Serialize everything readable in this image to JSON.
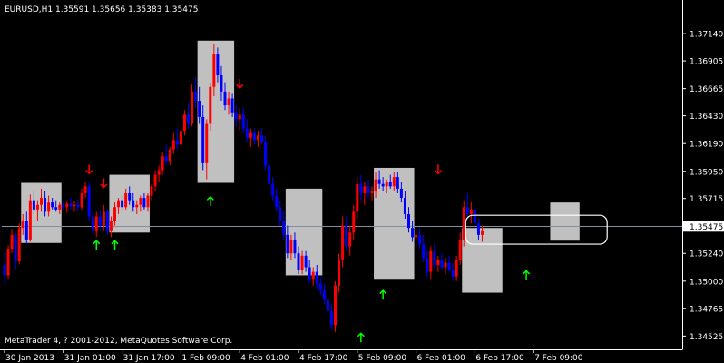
{
  "chart_data": {
    "type": "candlestick",
    "title": "EURUSD,H1  1.35591 1.35656 1.35383 1.35475",
    "footer": "MetaTrader 4, ? 2001-2012, MetaQuotes Software Corp.",
    "price_axis": {
      "ylim": [
        1.3441,
        1.374
      ],
      "ticks": [
        "1.37140",
        "1.36905",
        "1.36665",
        "1.36430",
        "1.36190",
        "1.35950",
        "1.35715",
        "1.35475",
        "1.35240",
        "1.35000",
        "1.34765",
        "1.34525"
      ],
      "current_price_label": "1.35475",
      "current_price": 1.35475
    },
    "time_axis": {
      "labels": [
        "30 Jan 2013",
        "31 Jan 01:00",
        "31 Jan 17:00",
        "1 Feb 09:00",
        "4 Feb 01:00",
        "4 Feb 17:00",
        "5 Feb 09:00",
        "6 Feb 01:00",
        "6 Feb 17:00",
        "7 Feb 09:00"
      ],
      "label_bar_index": [
        0,
        16,
        32,
        48,
        64,
        80,
        96,
        112,
        128,
        144
      ]
    },
    "colors": {
      "background": "#000000",
      "bull": "#ff0000",
      "bear": "#0000ff",
      "wick_bull": "#ff0000",
      "wick_bear": "#0000ff",
      "box": "#c0c0c0",
      "up_arrow": "#00ff00",
      "down_arrow": "#ff0000",
      "price_line": "#7f8fa8",
      "axis": "#ffffff"
    },
    "boxes": [
      {
        "bars": [
          5,
          15
        ],
        "low": 1.3533,
        "high": 1.3585
      },
      {
        "bars": [
          29,
          39
        ],
        "low": 1.3542,
        "high": 1.3592
      },
      {
        "bars": [
          53,
          62
        ],
        "low": 1.3585,
        "high": 1.3708
      },
      {
        "bars": [
          77,
          86
        ],
        "low": 1.3505,
        "high": 1.358
      },
      {
        "bars": [
          101,
          111
        ],
        "low": 1.3502,
        "high": 1.3598
      },
      {
        "bars": [
          125,
          135
        ],
        "low": 1.349,
        "high": 1.3546
      },
      {
        "bars": [
          149,
          156
        ],
        "low": 1.3535,
        "high": 1.3568
      }
    ],
    "rounded_box": {
      "bars": [
        126,
        164
      ],
      "low": 1.3532,
      "high": 1.3557
    },
    "arrows": [
      {
        "bar": 23,
        "dir": "down",
        "price": 1.3597
      },
      {
        "bar": 27,
        "dir": "down",
        "price": 1.3585
      },
      {
        "bar": 25,
        "dir": "up",
        "price": 1.3531
      },
      {
        "bar": 30,
        "dir": "up",
        "price": 1.3531
      },
      {
        "bar": 56,
        "dir": "up",
        "price": 1.3569
      },
      {
        "bar": 64,
        "dir": "down",
        "price": 1.3671
      },
      {
        "bar": 97,
        "dir": "up",
        "price": 1.3451
      },
      {
        "bar": 103,
        "dir": "up",
        "price": 1.3488
      },
      {
        "bar": 118,
        "dir": "down",
        "price": 1.3597
      },
      {
        "bar": 142,
        "dir": "up",
        "price": 1.3505
      }
    ],
    "candles": [
      [
        1.3514,
        1.3525,
        1.3498,
        1.3505
      ],
      [
        1.3505,
        1.3531,
        1.3502,
        1.3528
      ],
      [
        1.3528,
        1.3545,
        1.3524,
        1.354
      ],
      [
        1.354,
        1.3542,
        1.351,
        1.3517
      ],
      [
        1.3517,
        1.355,
        1.3515,
        1.3546
      ],
      [
        1.3546,
        1.3558,
        1.354,
        1.3552
      ],
      [
        1.3552,
        1.356,
        1.3532,
        1.3536
      ],
      [
        1.3536,
        1.3575,
        1.3534,
        1.357
      ],
      [
        1.357,
        1.3578,
        1.3558,
        1.3562
      ],
      [
        1.3562,
        1.357,
        1.3552,
        1.3566
      ],
      [
        1.3566,
        1.358,
        1.356,
        1.3572
      ],
      [
        1.3572,
        1.3578,
        1.3556,
        1.356
      ],
      [
        1.356,
        1.3574,
        1.3556,
        1.3568
      ],
      [
        1.3568,
        1.3572,
        1.3562,
        1.3564
      ],
      [
        1.3564,
        1.357,
        1.356,
        1.3562
      ],
      [
        1.3562,
        1.3568,
        1.3558,
        1.3566
      ],
      [
        1.3566,
        1.357,
        1.3562,
        1.3564
      ],
      [
        1.3564,
        1.3569,
        1.3559,
        1.3567
      ],
      [
        1.3567,
        1.3572,
        1.3562,
        1.3565
      ],
      [
        1.3565,
        1.3569,
        1.356,
        1.3566
      ],
      [
        1.3566,
        1.3571,
        1.3561,
        1.3564
      ],
      [
        1.3564,
        1.358,
        1.3562,
        1.3576
      ],
      [
        1.3576,
        1.3586,
        1.3572,
        1.3582
      ],
      [
        1.3582,
        1.3586,
        1.3552,
        1.3556
      ],
      [
        1.3556,
        1.3562,
        1.354,
        1.3544
      ],
      [
        1.3544,
        1.356,
        1.3538,
        1.3556
      ],
      [
        1.3556,
        1.3562,
        1.3544,
        1.3548
      ],
      [
        1.3548,
        1.3566,
        1.3544,
        1.356
      ],
      [
        1.356,
        1.3562,
        1.354,
        1.3544
      ],
      [
        1.3544,
        1.3556,
        1.3538,
        1.3552
      ],
      [
        1.3552,
        1.3568,
        1.3548,
        1.3564
      ],
      [
        1.3564,
        1.3572,
        1.3558,
        1.357
      ],
      [
        1.357,
        1.3574,
        1.356,
        1.3564
      ],
      [
        1.3564,
        1.358,
        1.3562,
        1.3576
      ],
      [
        1.3576,
        1.3582,
        1.3566,
        1.357
      ],
      [
        1.357,
        1.3576,
        1.356,
        1.3564
      ],
      [
        1.3564,
        1.357,
        1.3558,
        1.3566
      ],
      [
        1.3566,
        1.3574,
        1.356,
        1.3572
      ],
      [
        1.3572,
        1.3576,
        1.3562,
        1.3564
      ],
      [
        1.3564,
        1.3576,
        1.356,
        1.3574
      ],
      [
        1.3574,
        1.3584,
        1.357,
        1.3582
      ],
      [
        1.3582,
        1.3596,
        1.3578,
        1.3592
      ],
      [
        1.3592,
        1.36,
        1.3586,
        1.3596
      ],
      [
        1.3596,
        1.3612,
        1.3592,
        1.3608
      ],
      [
        1.3608,
        1.3618,
        1.36,
        1.3604
      ],
      [
        1.3604,
        1.3616,
        1.36,
        1.3614
      ],
      [
        1.3614,
        1.3628,
        1.361,
        1.3622
      ],
      [
        1.3622,
        1.3632,
        1.3614,
        1.3618
      ],
      [
        1.3618,
        1.3634,
        1.3616,
        1.363
      ],
      [
        1.363,
        1.3648,
        1.3626,
        1.3644
      ],
      [
        1.3644,
        1.3654,
        1.3632,
        1.3636
      ],
      [
        1.3636,
        1.367,
        1.3634,
        1.3664
      ],
      [
        1.3664,
        1.3676,
        1.365,
        1.3656
      ],
      [
        1.3656,
        1.3668,
        1.3636,
        1.3642
      ],
      [
        1.3642,
        1.3652,
        1.3596,
        1.3602
      ],
      [
        1.3602,
        1.364,
        1.3588,
        1.3636
      ],
      [
        1.3636,
        1.3672,
        1.363,
        1.3668
      ],
      [
        1.3668,
        1.3705,
        1.366,
        1.3696
      ],
      [
        1.3696,
        1.3702,
        1.3672,
        1.3678
      ],
      [
        1.3678,
        1.3686,
        1.3656,
        1.3664
      ],
      [
        1.3664,
        1.3672,
        1.3648,
        1.3652
      ],
      [
        1.3652,
        1.3664,
        1.3644,
        1.3658
      ],
      [
        1.3658,
        1.3662,
        1.3642,
        1.3646
      ],
      [
        1.3646,
        1.3652,
        1.3634,
        1.364
      ],
      [
        1.364,
        1.365,
        1.363,
        1.3644
      ],
      [
        1.3644,
        1.365,
        1.3628,
        1.3632
      ],
      [
        1.3632,
        1.364,
        1.362,
        1.3624
      ],
      [
        1.3624,
        1.3632,
        1.3616,
        1.3628
      ],
      [
        1.3628,
        1.3632,
        1.3618,
        1.3622
      ],
      [
        1.3622,
        1.363,
        1.3616,
        1.3626
      ],
      [
        1.3626,
        1.3632,
        1.3618,
        1.362
      ],
      [
        1.362,
        1.3626,
        1.3596,
        1.36
      ],
      [
        1.36,
        1.3606,
        1.358,
        1.3584
      ],
      [
        1.3584,
        1.359,
        1.357,
        1.3574
      ],
      [
        1.3574,
        1.358,
        1.356,
        1.3564
      ],
      [
        1.3564,
        1.357,
        1.3548,
        1.3552
      ],
      [
        1.3552,
        1.356,
        1.3536,
        1.354
      ],
      [
        1.354,
        1.3548,
        1.352,
        1.3524
      ],
      [
        1.3524,
        1.354,
        1.3518,
        1.3536
      ],
      [
        1.3536,
        1.3542,
        1.352,
        1.3524
      ],
      [
        1.3524,
        1.353,
        1.3506,
        1.351
      ],
      [
        1.351,
        1.3526,
        1.3506,
        1.3522
      ],
      [
        1.3522,
        1.3526,
        1.3508,
        1.3512
      ],
      [
        1.3512,
        1.3518,
        1.3498,
        1.3502
      ],
      [
        1.3502,
        1.3512,
        1.3496,
        1.3508
      ],
      [
        1.3508,
        1.3514,
        1.3494,
        1.3498
      ],
      [
        1.3498,
        1.3504,
        1.3488,
        1.3492
      ],
      [
        1.3492,
        1.3498,
        1.348,
        1.3484
      ],
      [
        1.3484,
        1.349,
        1.347,
        1.3474
      ],
      [
        1.3474,
        1.348,
        1.3458,
        1.3462
      ],
      [
        1.3462,
        1.35,
        1.3456,
        1.3496
      ],
      [
        1.3496,
        1.3524,
        1.349,
        1.3518
      ],
      [
        1.3518,
        1.3556,
        1.3512,
        1.3548
      ],
      [
        1.3548,
        1.3556,
        1.3526,
        1.353
      ],
      [
        1.353,
        1.3548,
        1.3522,
        1.3542
      ],
      [
        1.3542,
        1.3566,
        1.3536,
        1.356
      ],
      [
        1.356,
        1.359,
        1.3554,
        1.3584
      ],
      [
        1.3584,
        1.3592,
        1.357,
        1.3576
      ],
      [
        1.3576,
        1.3586,
        1.3566,
        1.3582
      ],
      [
        1.3582,
        1.3588,
        1.3572,
        1.3576
      ],
      [
        1.3576,
        1.3582,
        1.357,
        1.3578
      ],
      [
        1.3578,
        1.3594,
        1.3572,
        1.3588
      ],
      [
        1.3588,
        1.3596,
        1.358,
        1.3584
      ],
      [
        1.3584,
        1.359,
        1.3578,
        1.3582
      ],
      [
        1.3582,
        1.3588,
        1.3576,
        1.3586
      ],
      [
        1.3586,
        1.3592,
        1.358,
        1.3582
      ],
      [
        1.3582,
        1.3594,
        1.3578,
        1.359
      ],
      [
        1.359,
        1.3594,
        1.3576,
        1.358
      ],
      [
        1.358,
        1.3586,
        1.3568,
        1.3572
      ],
      [
        1.3572,
        1.3578,
        1.3554,
        1.3558
      ],
      [
        1.3558,
        1.3564,
        1.3542,
        1.3546
      ],
      [
        1.3546,
        1.3552,
        1.3534,
        1.3538
      ],
      [
        1.3538,
        1.3546,
        1.353,
        1.354
      ],
      [
        1.354,
        1.3546,
        1.3528,
        1.3532
      ],
      [
        1.3532,
        1.354,
        1.3516,
        1.352
      ],
      [
        1.352,
        1.3526,
        1.3504,
        1.3508
      ],
      [
        1.3508,
        1.353,
        1.3502,
        1.3526
      ],
      [
        1.3526,
        1.3532,
        1.351,
        1.3514
      ],
      [
        1.3514,
        1.3522,
        1.3508,
        1.3518
      ],
      [
        1.3518,
        1.3524,
        1.351,
        1.3512
      ],
      [
        1.3512,
        1.352,
        1.3506,
        1.3516
      ],
      [
        1.3516,
        1.3522,
        1.3508,
        1.351
      ],
      [
        1.351,
        1.3516,
        1.35,
        1.3504
      ],
      [
        1.3504,
        1.3522,
        1.35,
        1.3518
      ],
      [
        1.3518,
        1.3542,
        1.3514,
        1.3536
      ],
      [
        1.3536,
        1.357,
        1.353,
        1.3564
      ],
      [
        1.3564,
        1.3576,
        1.3554,
        1.3558
      ],
      [
        1.3558,
        1.3568,
        1.355,
        1.3562
      ],
      [
        1.3562,
        1.3566,
        1.3546,
        1.355
      ],
      [
        1.355,
        1.3554,
        1.3536,
        1.354
      ],
      [
        1.354,
        1.3548,
        1.3534,
        1.3544
      ]
    ]
  }
}
